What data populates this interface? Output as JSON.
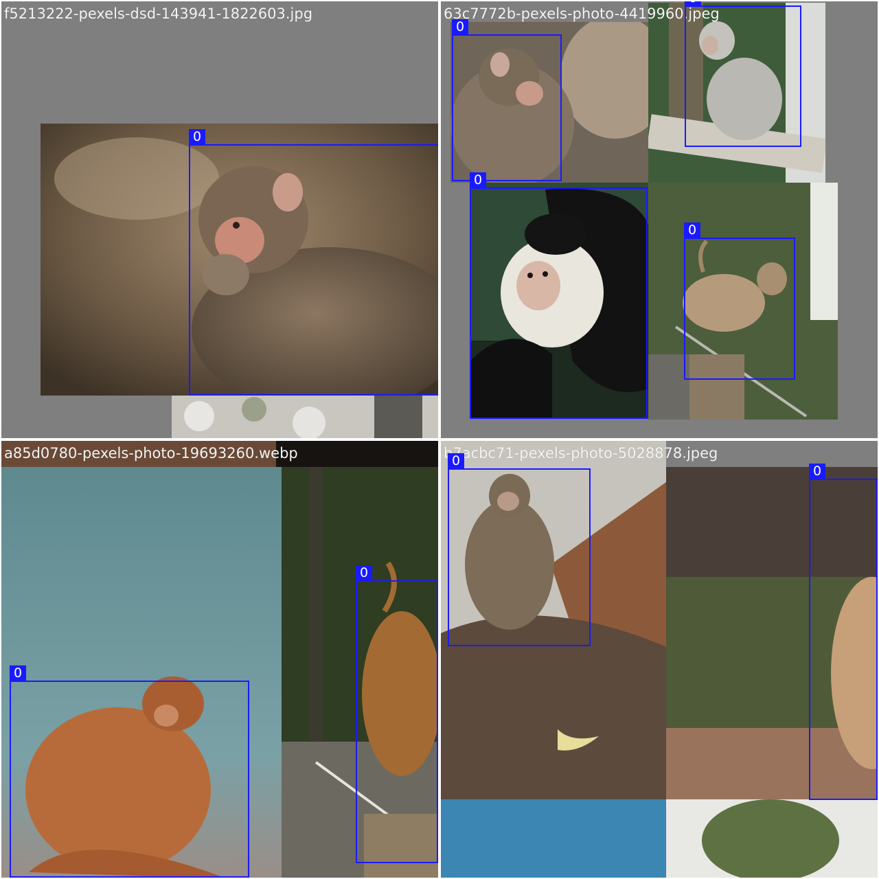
{
  "mosaic": {
    "tiles": [
      {
        "filename": "f5213222-pexels-dsd-143941-1822603.jpg",
        "photos": [
          {
            "subject": "baby-macaque",
            "boxes": [
              {
                "label": "0"
              }
            ]
          }
        ]
      },
      {
        "filename": "63c7772b-pexels-photo-4419960.jpeg",
        "photos": [
          {
            "subject": "baby-macaque-closeup",
            "boxes": [
              {
                "label": "0"
              }
            ]
          },
          {
            "subject": "grey-macaque-on-rail",
            "boxes": [
              {
                "label": "0"
              }
            ]
          },
          {
            "subject": "capuchin-monkey",
            "boxes": [
              {
                "label": "0"
              }
            ]
          },
          {
            "subject": "macaque-standing-on-post",
            "boxes": [
              {
                "label": "0"
              }
            ]
          }
        ]
      },
      {
        "filename": "a85d0780-pexels-photo-19693260.webp",
        "photos": [
          {
            "subject": "brown-macaque-sitting",
            "boxes": [
              {
                "label": "0"
              }
            ]
          },
          {
            "subject": "macaque-tail-on-post",
            "boxes": [
              {
                "label": "0"
              }
            ]
          }
        ]
      },
      {
        "filename": "b7acbc71-pexels-photo-5028878.jpeg",
        "photos": [
          {
            "subject": "long-tailed-macaque-on-rock",
            "boxes": [
              {
                "label": "0"
              }
            ]
          },
          {
            "subject": "macaque-leg-closeup",
            "boxes": [
              {
                "label": "0"
              }
            ]
          }
        ]
      }
    ],
    "colors": {
      "box": "#1a1aff",
      "label_text": "#ffffff",
      "tile_bg": "#7f7f7f"
    }
  }
}
